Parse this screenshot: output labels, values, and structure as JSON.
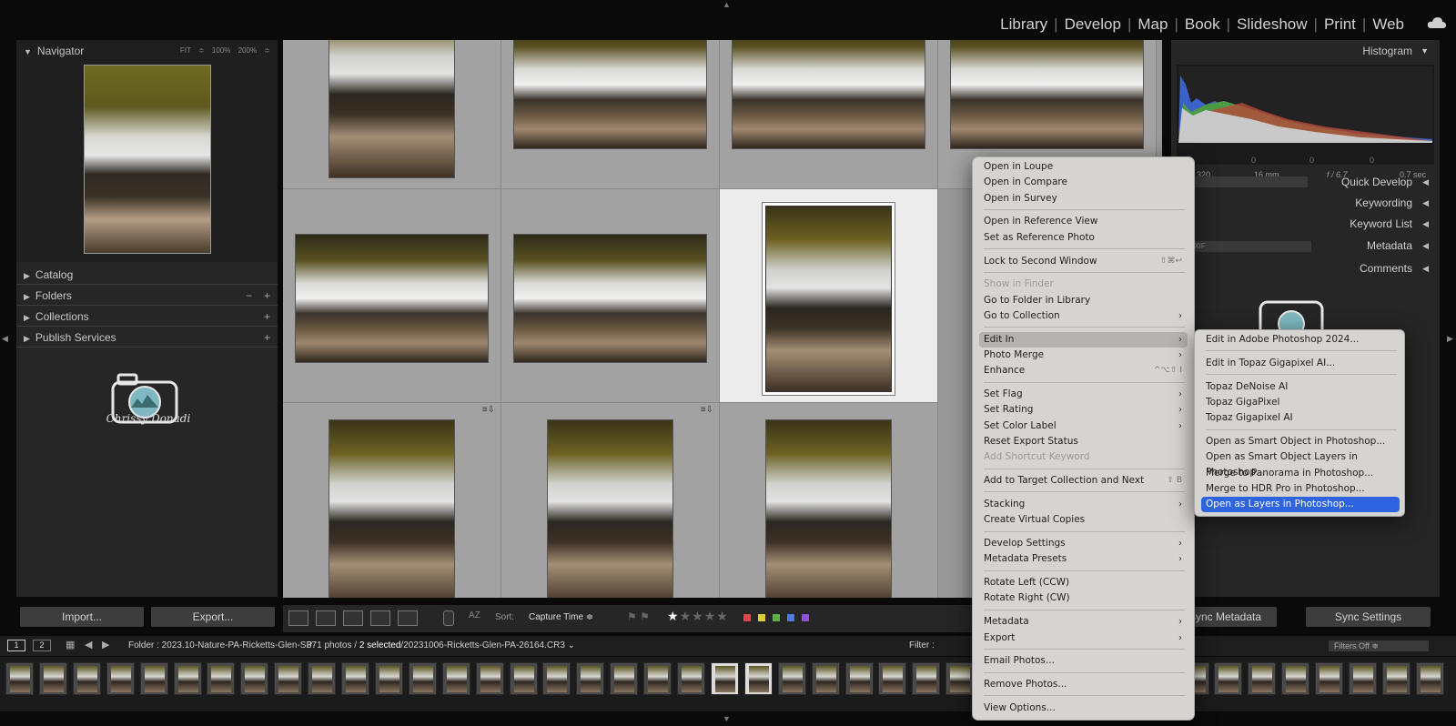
{
  "app": {
    "name": "Lightroom Classic"
  },
  "modules": [
    "Library",
    "Develop",
    "Map",
    "Book",
    "Slideshow",
    "Print",
    "Web"
  ],
  "icons": {
    "cloud": "cloud-icon",
    "grid": "grid-view-icon",
    "loupe": "loupe-view-icon",
    "compare": "compare-view-icon",
    "survey": "survey-view-icon",
    "people": "people-view-icon",
    "spray": "painter-icon",
    "flag": "flag-icon",
    "back": "back-arrow-icon",
    "forward": "forward-arrow-icon",
    "camera": "camera-logo-icon"
  },
  "left_panel": {
    "navigator": {
      "title": "Navigator",
      "options": "FIT ≑ 100% 200% ≑"
    },
    "sections": [
      {
        "label": "Catalog",
        "minus": "",
        "plus": ""
      },
      {
        "label": "Folders",
        "minus": "−",
        "plus": "+"
      },
      {
        "label": "Collections",
        "minus": "",
        "plus": "+"
      },
      {
        "label": "Publish Services",
        "minus": "",
        "plus": "+"
      }
    ],
    "identity_plate": "Chrissy Donadi",
    "import_label": "Import...",
    "export_label": "Export..."
  },
  "toolbar": {
    "sort_label": "Sort:",
    "sort_value": "Capture Time ≑",
    "rating": 1,
    "rating_stars": "★★★★★",
    "color_labels": [
      "#d94a4a",
      "#d9cf3f",
      "#5fae4a",
      "#4a7fd9",
      "#8a55d0"
    ]
  },
  "right_panel": {
    "histogram_title": "Histogram",
    "histogram_info": {
      "iso": "ISO 320",
      "focal": "16 mm",
      "aperture": "f / 6.7",
      "shutter": "0.7 sec"
    },
    "histogram_fields": [
      "0",
      "0",
      "0"
    ],
    "quick_develop": "Quick Develop",
    "quick_develop_preset": "stom",
    "keywording": "Keywording",
    "keyword_list": "Keyword List",
    "metadata": "Metadata",
    "metadata_preset": "EXIF",
    "comments": "Comments",
    "sync_metadata": "Sync Metadata",
    "sync_settings": "Sync Settings"
  },
  "filmstrip_bar": {
    "screen_1": "1",
    "screen_2": "2",
    "source": "Folder : 2023.10-Nature-PA-Ricketts-Glen-SP",
    "count_prefix": "371 photos /",
    "count_selected": "2 selected",
    "count_file": "/20231006-Ricketts-Glen-PA-26164.CR3 ⌄",
    "filter_label": "Filter :",
    "filters_off": "Filters Off ≑"
  },
  "context_menu": {
    "items": [
      {
        "label": "Open in Loupe",
        "shortcut": "",
        "submenu": false,
        "disabled": false
      },
      {
        "label": "Open in Compare",
        "shortcut": "",
        "submenu": false,
        "disabled": false
      },
      {
        "label": "Open in Survey",
        "shortcut": "",
        "submenu": false,
        "disabled": false
      },
      {
        "label": "Open in Reference View",
        "shortcut": "",
        "submenu": false,
        "disabled": false
      },
      {
        "label": "Set as Reference Photo",
        "shortcut": "",
        "submenu": false,
        "disabled": false
      },
      {
        "label": "Lock to Second Window",
        "shortcut": "⇧⌘↩",
        "submenu": false,
        "disabled": false
      },
      {
        "label": "Show in Finder",
        "shortcut": "",
        "submenu": false,
        "disabled": true
      },
      {
        "label": "Go to Folder in Library",
        "shortcut": "",
        "submenu": false,
        "disabled": false
      },
      {
        "label": "Go to Collection",
        "shortcut": "",
        "submenu": true,
        "disabled": false
      },
      {
        "label": "Edit In",
        "shortcut": "",
        "submenu": true,
        "disabled": false,
        "highlighted": true
      },
      {
        "label": "Photo Merge",
        "shortcut": "",
        "submenu": true,
        "disabled": false
      },
      {
        "label": "Enhance",
        "shortcut": "^⌥⇧ I",
        "submenu": false,
        "disabled": false
      },
      {
        "label": "Set Flag",
        "shortcut": "",
        "submenu": true,
        "disabled": false
      },
      {
        "label": "Set Rating",
        "shortcut": "",
        "submenu": true,
        "disabled": false
      },
      {
        "label": "Set Color Label",
        "shortcut": "",
        "submenu": true,
        "disabled": false
      },
      {
        "label": "Reset Export Status",
        "shortcut": "",
        "submenu": false,
        "disabled": false
      },
      {
        "label": "Add Shortcut Keyword",
        "shortcut": "",
        "submenu": false,
        "disabled": true
      },
      {
        "label": "Add to Target Collection and Next",
        "shortcut": "⇧ B",
        "submenu": false,
        "disabled": false
      },
      {
        "label": "Stacking",
        "shortcut": "",
        "submenu": true,
        "disabled": false
      },
      {
        "label": "Create Virtual Copies",
        "shortcut": "",
        "submenu": false,
        "disabled": false
      },
      {
        "label": "Develop Settings",
        "shortcut": "",
        "submenu": true,
        "disabled": false
      },
      {
        "label": "Metadata Presets",
        "shortcut": "",
        "submenu": true,
        "disabled": false
      },
      {
        "label": "Rotate Left (CCW)",
        "shortcut": "",
        "submenu": false,
        "disabled": false
      },
      {
        "label": "Rotate Right (CW)",
        "shortcut": "",
        "submenu": false,
        "disabled": false
      },
      {
        "label": "Metadata",
        "shortcut": "",
        "submenu": true,
        "disabled": false
      },
      {
        "label": "Export",
        "shortcut": "",
        "submenu": true,
        "disabled": false
      },
      {
        "label": "Email Photos...",
        "shortcut": "",
        "submenu": false,
        "disabled": false
      },
      {
        "label": "Remove Photos...",
        "shortcut": "",
        "submenu": false,
        "disabled": false
      },
      {
        "label": "View Options...",
        "shortcut": "",
        "submenu": false,
        "disabled": false
      }
    ]
  },
  "edit_in_submenu": {
    "items": [
      {
        "label": "Edit in Adobe Photoshop 2024..."
      },
      {
        "label": "Edit in Topaz Gigapixel AI..."
      },
      {
        "label": "Topaz DeNoise AI"
      },
      {
        "label": "Topaz GigaPixel"
      },
      {
        "label": "Topaz Gigapixel AI"
      },
      {
        "label": "Open as Smart Object in Photoshop..."
      },
      {
        "label": "Open as Smart Object Layers in Photoshop..."
      },
      {
        "label": "Merge to Panorama in Photoshop..."
      },
      {
        "label": "Merge to HDR Pro in Photoshop..."
      },
      {
        "label": "Open as Layers in Photoshop...",
        "active": true
      }
    ]
  }
}
